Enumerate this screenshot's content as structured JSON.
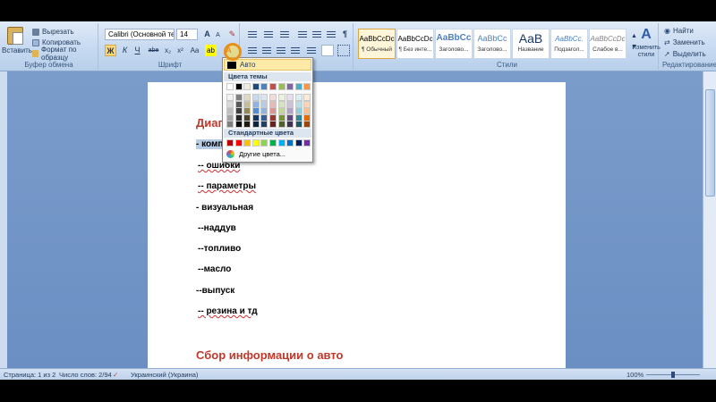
{
  "clipboard": {
    "paste_label": "Вставить",
    "cut_label": "Вырезать",
    "copy_label": "Копировать",
    "format_painter_label": "Формат по образцу",
    "group_label": "Буфер обмена"
  },
  "font": {
    "font_name": "Calibri (Основной текст)",
    "font_size": "14",
    "group_label": "Шрифт",
    "grow_label": "A",
    "shrink_label": "A",
    "bold_label": "Ж",
    "italic_label": "К",
    "underline_label": "Ч",
    "strike_label": "abe",
    "subscript_label": "x₂",
    "superscript_label": "x²",
    "case_label": "Aa"
  },
  "paragraph": {
    "group_label": "Абзац",
    "show_marks": "¶"
  },
  "styles": {
    "group_label": "Стили",
    "tiles": [
      {
        "sample": "AaBbCcDc",
        "name": "¶ Обычный",
        "active": true
      },
      {
        "sample": "AaBbCcDc",
        "name": "¶ Без инте...",
        "active": false
      },
      {
        "sample": "AaBbCc",
        "name": "Заголово...",
        "active": false
      },
      {
        "sample": "AaBbCc",
        "name": "Заголово...",
        "active": false
      },
      {
        "sample": "AaB",
        "name": "Название",
        "active": false
      },
      {
        "sample": "AaBbCc.",
        "name": "Подзагол...",
        "active": false
      },
      {
        "sample": "AaBbCcDc",
        "name": "Слабое в...",
        "active": false
      }
    ],
    "change_styles_label": "Изменить стили"
  },
  "editing": {
    "group_label": "Редактирование",
    "find_label": "Найти",
    "replace_label": "Заменить",
    "select_label": "Выделить"
  },
  "color_dropdown": {
    "auto_label": "Авто",
    "theme_header": "Цвета темы",
    "standard_header": "Стандартные цвета",
    "more_label": "Другие цвета...",
    "theme_top": [
      "#ffffff",
      "#000000",
      "#eeece1",
      "#1f497d",
      "#4f81bd",
      "#c0504d",
      "#9bbb59",
      "#8064a2",
      "#4bacc6",
      "#f79646"
    ],
    "theme_shades": [
      [
        "#f2f2f2",
        "#7f7f7f",
        "#ddd9c3",
        "#c6d9f0",
        "#dbe5f1",
        "#f2dcdb",
        "#ebf1dd",
        "#e5e0ec",
        "#dbeef3",
        "#fdeada"
      ],
      [
        "#d8d8d8",
        "#595959",
        "#c4bd97",
        "#8db3e2",
        "#b8cce4",
        "#e5b9b7",
        "#d7e3bc",
        "#ccc1d9",
        "#b7dde8",
        "#fbd5b5"
      ],
      [
        "#bfbfbf",
        "#3f3f3f",
        "#938953",
        "#548dd4",
        "#95b3d7",
        "#d99694",
        "#c3d69b",
        "#b2a2c7",
        "#92cddc",
        "#fac08f"
      ],
      [
        "#a5a5a5",
        "#262626",
        "#494429",
        "#17365d",
        "#366092",
        "#953734",
        "#76923c",
        "#5f497a",
        "#31859b",
        "#e36c09"
      ],
      [
        "#7f7f7f",
        "#0c0c0c",
        "#1d1b10",
        "#0f243e",
        "#244061",
        "#632423",
        "#4f6128",
        "#3f3151",
        "#205867",
        "#974806"
      ]
    ],
    "standard": [
      "#c00000",
      "#ff0000",
      "#ffc000",
      "#ffff00",
      "#92d050",
      "#00b050",
      "#00b0f0",
      "#0070c0",
      "#002060",
      "#7030a0"
    ]
  },
  "document": {
    "heading1": "Диаг",
    "line_selected": "- комп",
    "lines": [
      {
        "text": "-- ошибки",
        "squiggle": true
      },
      {
        "text": "-- параметры",
        "squiggle": true
      },
      {
        "text": "- визуальная",
        "squiggle": false
      },
      {
        "text": "--наддув",
        "squiggle": false
      },
      {
        "text": "--топливо",
        "squiggle": false
      },
      {
        "text": "--масло",
        "squiggle": false
      },
      {
        "text": "--выпуск",
        "squiggle": false
      },
      {
        "text": "-- резина и тд",
        "squiggle": true
      }
    ],
    "heading2": "Сбор информации о авто"
  },
  "status": {
    "page": "Страница: 1 из 2",
    "words": "Число слов: 2/94",
    "language": "Украинский (Украина)",
    "zoom": "100%"
  }
}
